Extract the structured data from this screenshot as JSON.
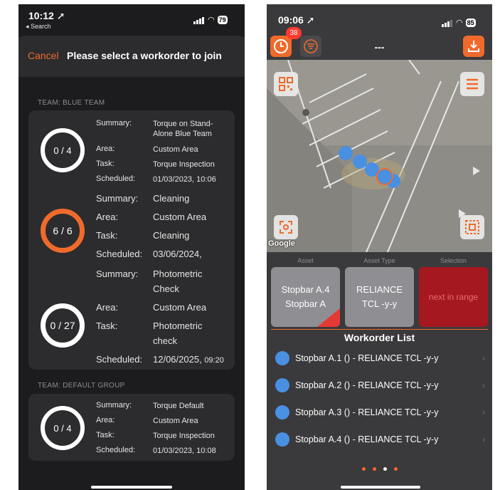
{
  "left": {
    "status": {
      "time": "10:12 ➚",
      "back": "◂ Search",
      "battery": "79"
    },
    "header": {
      "cancel": "Cancel",
      "title": "Please select a workorder to join"
    },
    "teams": [
      {
        "label": "TEAM: BLUE TEAM",
        "items": [
          {
            "progress": "0 / 4",
            "ring_color": "#ffffff",
            "summary_key": "Summary:",
            "summary": "Torque on Stand-Alone Blue Team",
            "area_key": "Area:",
            "area": "Custom Area",
            "task_key": "Task:",
            "task": "Torque Inspection",
            "scheduled_key": "Scheduled:",
            "scheduled": "01/03/2023, 10:06"
          },
          {
            "progress": "6 / 6",
            "ring_color": "#f06a2b",
            "summary_key": "Summary:",
            "summary": "Cleaning",
            "area_key": "Area:",
            "area": "Custom Area",
            "task_key": "Task:",
            "task": "Cleaning",
            "scheduled_key": "Scheduled:",
            "scheduled": "03/06/2024,"
          },
          {
            "progress": "0 / 27",
            "ring_color": "#ffffff",
            "summary_key": "Summary:",
            "summary": "Photometric Check",
            "area_key": "Area:",
            "area": "Custom Area",
            "task_key": "Task:",
            "task": "Photometric check",
            "scheduled_key": "Scheduled:",
            "scheduled": "12/06/2025,",
            "scheduled_time": "09:20"
          }
        ]
      },
      {
        "label": "TEAM: DEFAULT GROUP",
        "items": [
          {
            "progress": "0 / 4",
            "ring_color": "#ffffff",
            "summary_key": "Summary:",
            "summary": "Torque Default",
            "area_key": "Area:",
            "area": "Custom Area",
            "task_key": "Task:",
            "task": "Torque Inspection",
            "scheduled_key": "Scheduled:",
            "scheduled": "01/03/2023, 10:08"
          }
        ]
      }
    ]
  },
  "right": {
    "status": {
      "time": "09:06 ➚",
      "battery": "85"
    },
    "toolbar": {
      "badge": "38",
      "title": "---"
    },
    "map": {
      "google": "Google"
    },
    "selection": {
      "headers": [
        "Asset",
        "Asset Type",
        "Selection"
      ],
      "asset_line1": "Stopbar A.4",
      "asset_line2": "Stopbar A",
      "type_line1": "RELIANCE",
      "type_line2": "TCL -y-y",
      "next": "next in range"
    },
    "workorder_list": {
      "title": "Workorder List",
      "items": [
        "Stopbar A.1 () - RELIANCE TCL -y-y",
        "Stopbar A.2 () - RELIANCE TCL -y-y",
        "Stopbar A.3 () - RELIANCE TCL -y-y",
        "Stopbar A.4 () - RELIANCE TCL -y-y"
      ],
      "chevron": "›"
    }
  },
  "colors": {
    "accent": "#f06a2b",
    "point_blue": "#4a90e2",
    "danger": "#a6181f"
  },
  "icons": [
    "location-arrow-icon",
    "signal-icon",
    "wifi-icon",
    "battery-icon",
    "clock-icon",
    "filter-icon",
    "download-icon",
    "qr-map-icon",
    "menu-icon",
    "recenter-icon",
    "select-area-icon",
    "chevron-right-icon"
  ]
}
